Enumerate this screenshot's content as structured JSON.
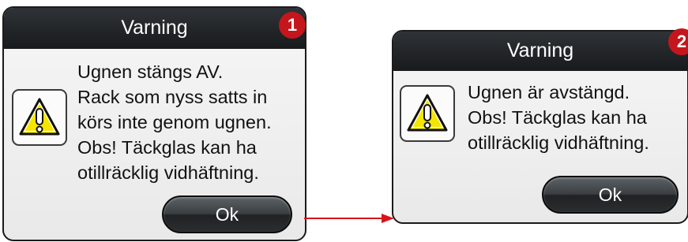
{
  "colors": {
    "titlebar": "#1f2224",
    "badge": "#c4161c",
    "arrow": "#d8141a",
    "warning_icon_fill": "#f5e600"
  },
  "dialogs": [
    {
      "title": "Varning",
      "icon": "warning-triangle-icon",
      "message": "Ugnen stängs AV.\nRack som nyss satts in\nkörs inte genom ugnen.\nObs! Täckglas kan ha\notillräcklig vidhäftning.",
      "ok_label": "Ok",
      "badge": "1"
    },
    {
      "title": "Varning",
      "icon": "warning-triangle-icon",
      "message": "Ugnen är avstängd.\nObs! Täckglas kan ha\notillräcklig vidhäftning.",
      "ok_label": "Ok",
      "badge": "2"
    }
  ],
  "connector": {
    "icon": "arrow-right-icon"
  }
}
